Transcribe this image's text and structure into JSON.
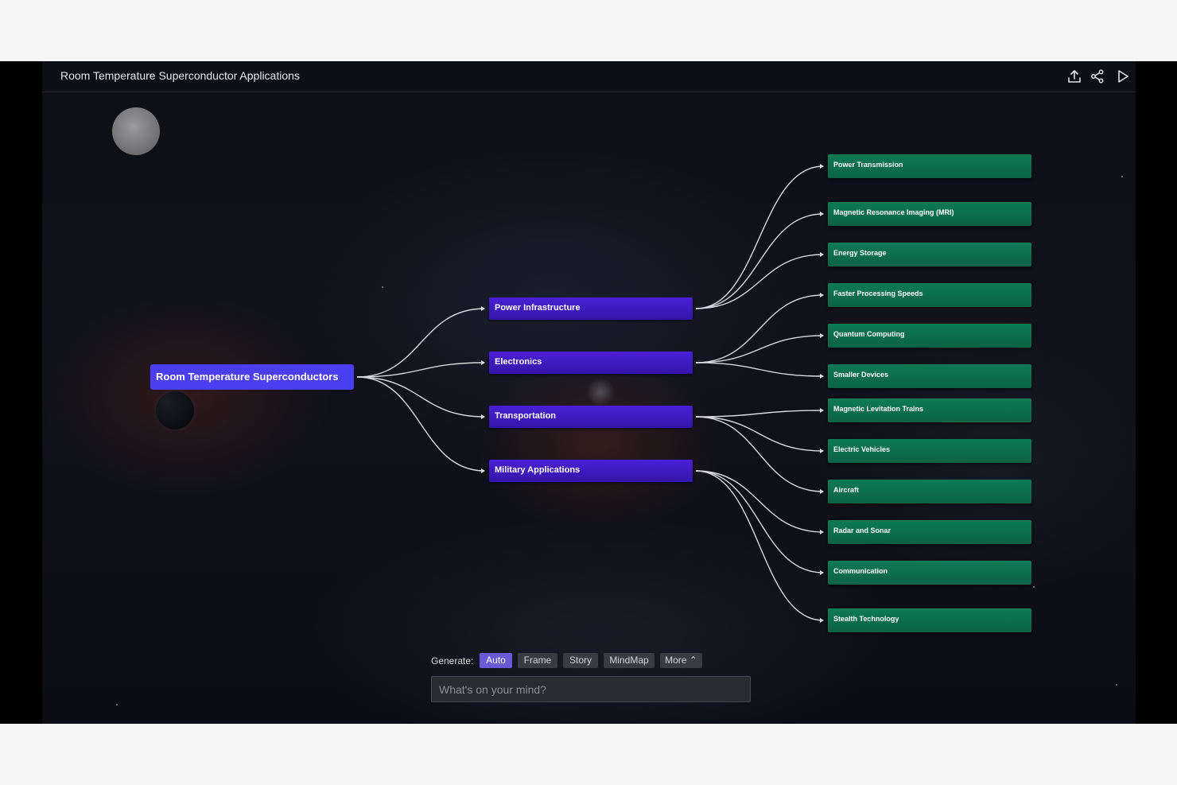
{
  "header": {
    "title": "Room Temperature Superconductor Applications",
    "icons": [
      "upload-icon",
      "share-icon",
      "play-icon"
    ]
  },
  "mindmap": {
    "root": "Room Temperature Superconductors",
    "branches": [
      {
        "label": "Power Infrastructure",
        "children": [
          "Power Transmission",
          "Magnetic Resonance Imaging (MRI)",
          "Energy Storage"
        ]
      },
      {
        "label": "Electronics",
        "children": [
          "Faster Processing Speeds",
          "Quantum Computing",
          "Smaller Devices"
        ]
      },
      {
        "label": "Transportation",
        "children": [
          "Magnetic Levitation Trains",
          "Electric Vehicles",
          "Aircraft"
        ]
      },
      {
        "label": "Military Applications",
        "children": [
          "Radar and Sonar",
          "Communication",
          "Stealth Technology"
        ]
      }
    ]
  },
  "generate": {
    "label": "Generate:",
    "options": [
      "Auto",
      "Frame",
      "Story",
      "MindMap",
      "More ⌃"
    ],
    "active": "Auto"
  },
  "prompt": {
    "placeholder": "What's on your mind?"
  },
  "colors": {
    "root": "#4a3ef0",
    "branch": "#3d18c0",
    "leaf": "#0b6e4c",
    "background": "#0e1018"
  }
}
